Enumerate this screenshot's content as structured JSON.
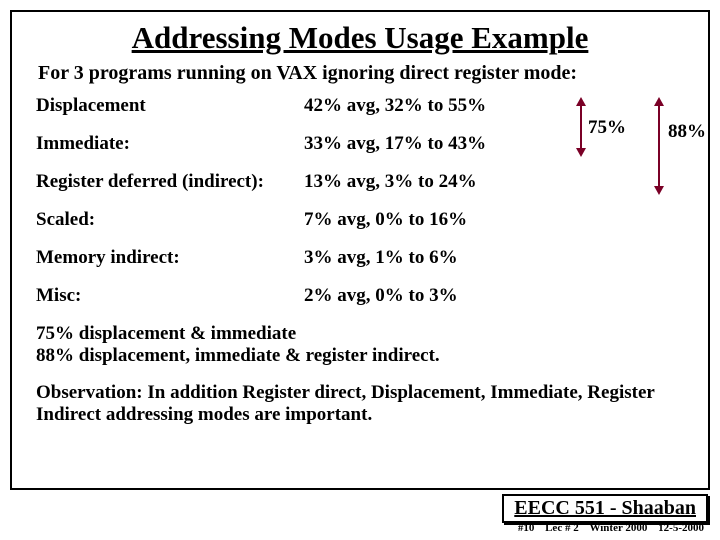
{
  "title": "Addressing Modes Usage Example",
  "subtitle": "For 3 programs running on VAX ignoring direct register mode:",
  "rows": [
    {
      "mode": "Displacement",
      "stat": "42% avg, 32% to 55%"
    },
    {
      "mode": "Immediate:",
      "stat": "33% avg, 17% to 43%"
    },
    {
      "mode": "Register deferred (indirect):",
      "stat": "13% avg, 3% to 24%"
    },
    {
      "mode": "Scaled:",
      "stat": "7% avg, 0% to 16%"
    },
    {
      "mode": "Memory indirect:",
      "stat": "3% avg, 1% to 6%"
    },
    {
      "mode": "Misc:",
      "stat": "2% avg, 0% to 3%"
    }
  ],
  "arrows": {
    "top2": "75%",
    "top3": "88%"
  },
  "summary_line1": "75% displacement & immediate",
  "summary_line2": "88% displacement, immediate & register indirect.",
  "observation": "Observation:  In addition Register direct, Displacement, Immediate, Register Indirect addressing modes are important.",
  "attribution": "EECC 551 - Shaaban",
  "footer": {
    "slide": "#10",
    "lec": "Lec # 2",
    "term": "Winter 2000",
    "date": "12-5-2000"
  }
}
